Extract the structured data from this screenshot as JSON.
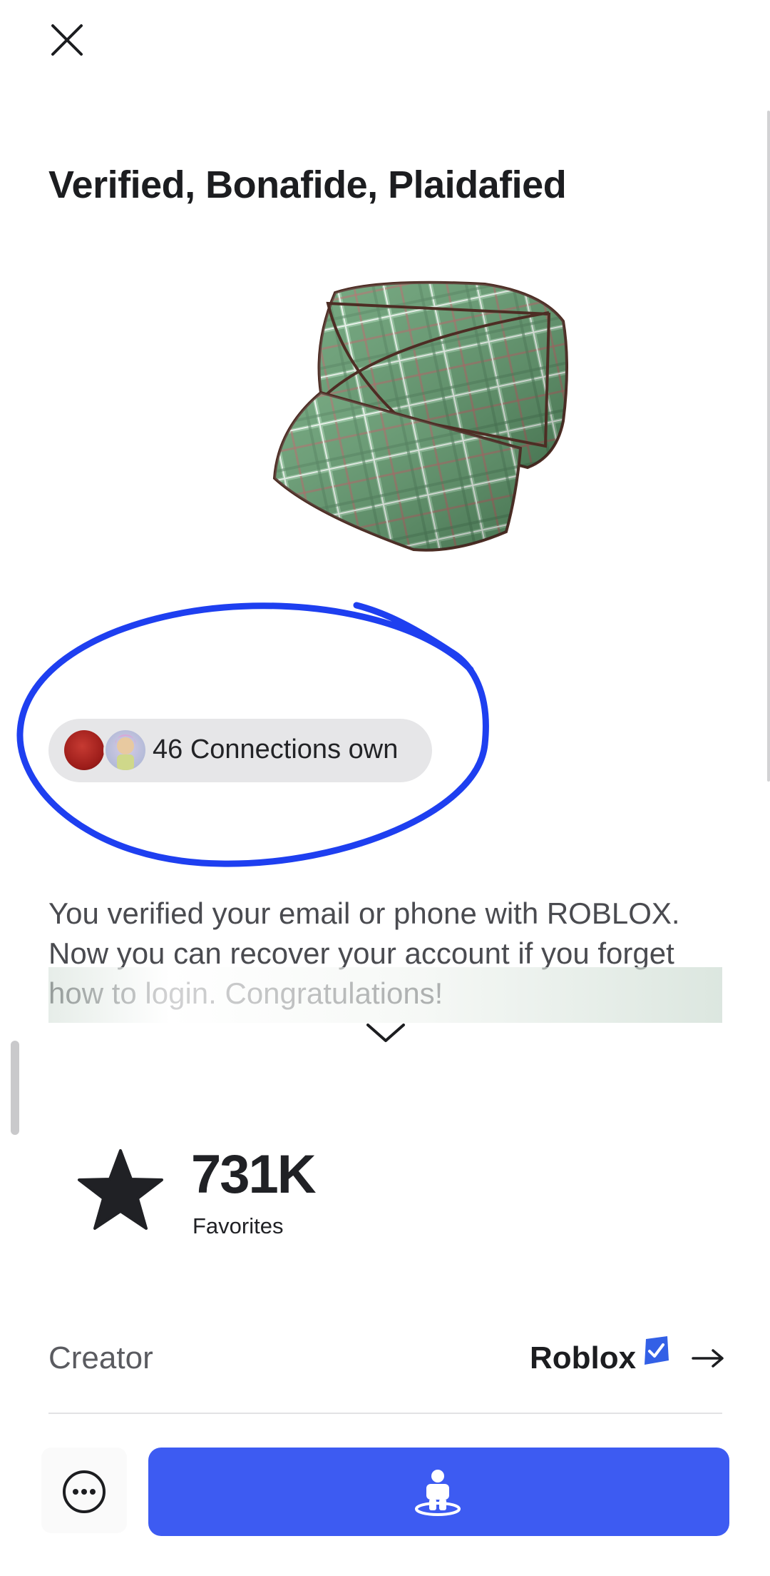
{
  "item": {
    "title": "Verified, Bonafide, Plaidafied",
    "description": "You verified your email or phone with ROBLOX.  Now you can recover your account if you forget how to login.  Congratulations!"
  },
  "connections": {
    "text": "46 Connections own"
  },
  "favorites": {
    "count": "731K",
    "label": "Favorites"
  },
  "creator": {
    "label": "Creator",
    "name": "Roblox"
  },
  "icons": {
    "close": "close-icon",
    "expand": "chevron-down-icon",
    "favorites": "star-icon",
    "verified": "verified-badge-icon",
    "creator_arrow": "arrow-right-icon",
    "more": "more-options-icon",
    "try_on": "avatar-try-on-icon"
  },
  "colors": {
    "primary_button": "#3d5bf2",
    "annotation_stroke": "#1e3ff0",
    "verified_badge": "#3360e6",
    "hat_green": "#5f9a6c"
  }
}
